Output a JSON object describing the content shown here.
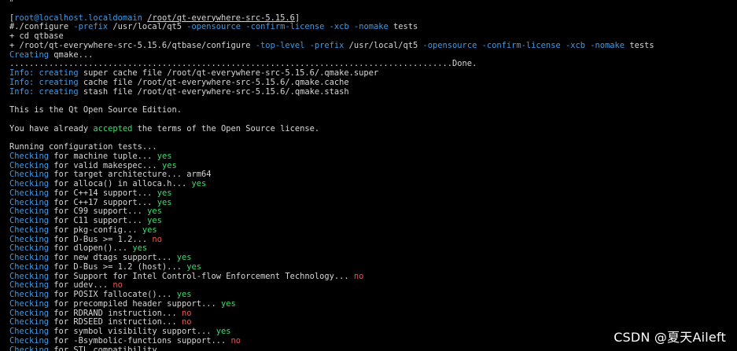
{
  "terminal": {
    "lines": [
      [
        {
          "t": "#"
        }
      ],
      [],
      [
        {
          "t": "["
        },
        {
          "t": "root@localhost.localdomain",
          "c": "blue"
        },
        {
          "t": " "
        },
        {
          "t": "/root/qt-everywhere-src-5.15.6",
          "u": true
        },
        {
          "t": "]"
        }
      ],
      [
        {
          "t": "#./configure "
        },
        {
          "t": "-prefix",
          "c": "blue"
        },
        {
          "t": " /usr/local/qt5 "
        },
        {
          "t": "-opensource",
          "c": "blue"
        },
        {
          "t": " "
        },
        {
          "t": "-confirm-license",
          "c": "blue"
        },
        {
          "t": " "
        },
        {
          "t": "-xcb",
          "c": "blue"
        },
        {
          "t": " "
        },
        {
          "t": "-nomake",
          "c": "blue"
        },
        {
          "t": " tests"
        }
      ],
      [
        {
          "t": "+ cd qtbase"
        }
      ],
      [
        {
          "t": "+ /root/qt-everywhere-src-5.15.6/qtbase/configure "
        },
        {
          "t": "-top-level",
          "c": "blue"
        },
        {
          "t": " "
        },
        {
          "t": "-prefix",
          "c": "blue"
        },
        {
          "t": " /usr/local/qt5 "
        },
        {
          "t": "-opensource",
          "c": "blue"
        },
        {
          "t": " "
        },
        {
          "t": "-confirm-license",
          "c": "blue"
        },
        {
          "t": " "
        },
        {
          "t": "-xcb",
          "c": "blue"
        },
        {
          "t": " "
        },
        {
          "t": "-nomake",
          "c": "blue"
        },
        {
          "t": " tests"
        }
      ],
      [
        {
          "t": "Creating",
          "c": "blue"
        },
        {
          "t": " qmake..."
        }
      ],
      [
        {
          "t": "..........................................................................................Done."
        }
      ],
      [
        {
          "t": "Info:",
          "c": "blue"
        },
        {
          "t": " "
        },
        {
          "t": "creating",
          "c": "blue"
        },
        {
          "t": " super cache file /root/qt-everywhere-src-5.15.6/.qmake.super"
        }
      ],
      [
        {
          "t": "Info:",
          "c": "blue"
        },
        {
          "t": " "
        },
        {
          "t": "creating",
          "c": "blue"
        },
        {
          "t": " cache file /root/qt-everywhere-src-5.15.6/.qmake.cache"
        }
      ],
      [
        {
          "t": "Info:",
          "c": "blue"
        },
        {
          "t": " "
        },
        {
          "t": "creating",
          "c": "blue"
        },
        {
          "t": " stash file /root/qt-everywhere-src-5.15.6/.qmake.stash"
        }
      ],
      [],
      [
        {
          "t": "This is the Qt Open Source Edition."
        }
      ],
      [],
      [
        {
          "t": "You have already "
        },
        {
          "t": "accepted",
          "c": "green"
        },
        {
          "t": " the terms of the Open Source license."
        }
      ],
      [],
      [
        {
          "t": "Running configuration tests..."
        }
      ],
      [
        {
          "t": "Checking",
          "c": "blue"
        },
        {
          "t": " for machine tuple... "
        },
        {
          "t": "yes",
          "c": "green"
        }
      ],
      [
        {
          "t": "Checking",
          "c": "blue"
        },
        {
          "t": " for valid makespec... "
        },
        {
          "t": "yes",
          "c": "green"
        }
      ],
      [
        {
          "t": "Checking",
          "c": "blue"
        },
        {
          "t": " for target architecture... arm64"
        }
      ],
      [
        {
          "t": "Checking",
          "c": "blue"
        },
        {
          "t": " for alloca() in alloca.h... "
        },
        {
          "t": "yes",
          "c": "green"
        }
      ],
      [
        {
          "t": "Checking",
          "c": "blue"
        },
        {
          "t": " for C++14 support... "
        },
        {
          "t": "yes",
          "c": "green"
        }
      ],
      [
        {
          "t": "Checking",
          "c": "blue"
        },
        {
          "t": " for C++17 support... "
        },
        {
          "t": "yes",
          "c": "green"
        }
      ],
      [
        {
          "t": "Checking",
          "c": "blue"
        },
        {
          "t": " for C99 support... "
        },
        {
          "t": "yes",
          "c": "green"
        }
      ],
      [
        {
          "t": "Checking",
          "c": "blue"
        },
        {
          "t": " for C11 support... "
        },
        {
          "t": "yes",
          "c": "green"
        }
      ],
      [
        {
          "t": "Checking",
          "c": "blue"
        },
        {
          "t": " for pkg-config... "
        },
        {
          "t": "yes",
          "c": "green"
        }
      ],
      [
        {
          "t": "Checking",
          "c": "blue"
        },
        {
          "t": " for D-Bus >= 1.2... "
        },
        {
          "t": "no",
          "c": "red"
        }
      ],
      [
        {
          "t": "Checking",
          "c": "blue"
        },
        {
          "t": " for dlopen()... "
        },
        {
          "t": "yes",
          "c": "green"
        }
      ],
      [
        {
          "t": "Checking",
          "c": "blue"
        },
        {
          "t": " for new dtags support... "
        },
        {
          "t": "yes",
          "c": "green"
        }
      ],
      [
        {
          "t": "Checking",
          "c": "blue"
        },
        {
          "t": " for D-Bus >= 1.2 (host)... "
        },
        {
          "t": "yes",
          "c": "green"
        }
      ],
      [
        {
          "t": "Checking",
          "c": "blue"
        },
        {
          "t": " for Support for Intel Control-flow Enforcement Technology... "
        },
        {
          "t": "no",
          "c": "red"
        }
      ],
      [
        {
          "t": "Checking",
          "c": "blue"
        },
        {
          "t": " for udev... "
        },
        {
          "t": "no",
          "c": "red"
        }
      ],
      [
        {
          "t": "Checking",
          "c": "blue"
        },
        {
          "t": " for POSIX fallocate()... "
        },
        {
          "t": "yes",
          "c": "green"
        }
      ],
      [
        {
          "t": "Checking",
          "c": "blue"
        },
        {
          "t": " for precompiled header support... "
        },
        {
          "t": "yes",
          "c": "green"
        }
      ],
      [
        {
          "t": "Checking",
          "c": "blue"
        },
        {
          "t": " for RDRAND instruction... "
        },
        {
          "t": "no",
          "c": "red"
        }
      ],
      [
        {
          "t": "Checking",
          "c": "blue"
        },
        {
          "t": " for RDSEED instruction... "
        },
        {
          "t": "no",
          "c": "red"
        }
      ],
      [
        {
          "t": "Checking",
          "c": "blue"
        },
        {
          "t": " for symbol visibility support... "
        },
        {
          "t": "yes",
          "c": "green"
        }
      ],
      [
        {
          "t": "Checking",
          "c": "blue"
        },
        {
          "t": " for -Bsymbolic-functions support... "
        },
        {
          "t": "no",
          "c": "red"
        }
      ],
      [
        {
          "t": "Checking",
          "c": "blue"
        },
        {
          "t": " for STL compatibility... "
        }
      ]
    ]
  },
  "watermark": "CSDN @夏天Aileft",
  "colors": {
    "background": "#000000",
    "text": "#d6d6d6",
    "blue": "#3d9be6",
    "green": "#3ddc6b",
    "red": "#e55656"
  }
}
